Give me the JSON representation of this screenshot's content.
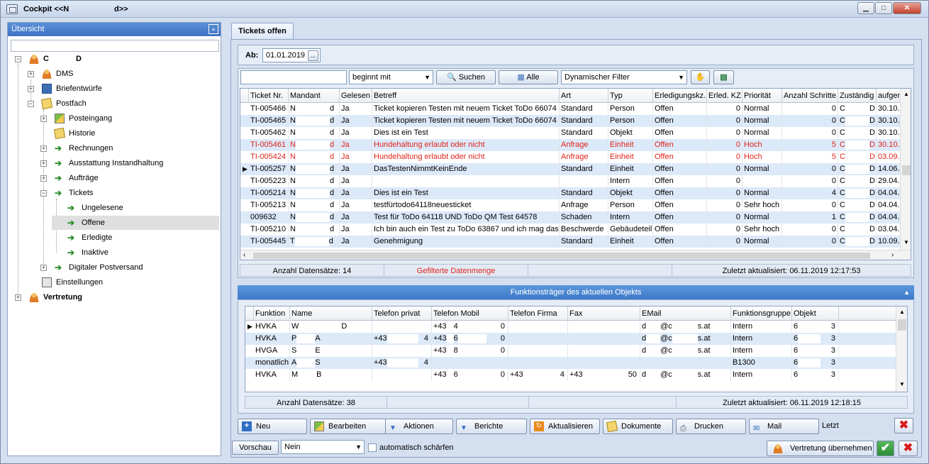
{
  "window": {
    "title": "Cockpit  <<N",
    "title_suffix": "d>>",
    "minimize": "▁",
    "maximize": "□",
    "close": "✕"
  },
  "sidebar": {
    "header": "Übersicht",
    "collapse": "«",
    "root": {
      "label": "C",
      "label2": "D"
    },
    "items": [
      {
        "label": "DMS"
      },
      {
        "label": "Briefentwürfe"
      },
      {
        "label": "Postfach"
      },
      {
        "label": "Posteingang"
      },
      {
        "label": "Historie"
      },
      {
        "label": "Rechnungen"
      },
      {
        "label": "Ausstattung Instandhaltung"
      },
      {
        "label": "Aufträge"
      },
      {
        "label": "Tickets"
      },
      {
        "label": "Ungelesene"
      },
      {
        "label": "Offene"
      },
      {
        "label": "Erledigte"
      },
      {
        "label": "Inaktive"
      },
      {
        "label": "Digitaler Postversand"
      },
      {
        "label": "Einstellungen"
      },
      {
        "label": "Vertretung"
      }
    ]
  },
  "tab": {
    "label": "Tickets offen"
  },
  "filter": {
    "ab_label": "Ab:",
    "ab_value": "01.01.2019",
    "ab_button": "...",
    "search_value": "",
    "mode_value": "beginnt mit",
    "search_button": "Suchen",
    "all_button": "Alle",
    "dynamic_filter": "Dynamischer Filter"
  },
  "tickets": {
    "columns": [
      "Ticket Nr.",
      "Mandant",
      "Gelesen",
      "Betreff",
      "Art",
      "Typ",
      "Erledigungskz.",
      "Erled. KZ",
      "Priorität",
      "Anzahl Schritte",
      "Zuständig",
      "aufgen"
    ],
    "rows": [
      {
        "nr": "TI-005466",
        "m1": "N",
        "m2": "d",
        "gel": "Ja",
        "betreff": "Ticket kopieren Testen mit neuem Ticket ToDo 66074",
        "art": "Standard",
        "typ": "Person",
        "erl": "Offen",
        "kz": "0",
        "prio": "Normal",
        "schritte": "0",
        "z1": "C",
        "z2": "D",
        "auf": "30.10."
      },
      {
        "nr": "TI-005465",
        "m1": "N",
        "m2": "d",
        "gel": "Ja",
        "betreff": "Ticket kopieren Testen mit neuem Ticket ToDo 66074",
        "art": "Standard",
        "typ": "Person",
        "erl": "Offen",
        "kz": "0",
        "prio": "Normal",
        "schritte": "0",
        "z1": "C",
        "z2": "D",
        "auf": "30.10."
      },
      {
        "nr": "TI-005462",
        "m1": "N",
        "m2": "d",
        "gel": "Ja",
        "betreff": "Dies ist ein Test",
        "art": "Standard",
        "typ": "Objekt",
        "erl": "Offen",
        "kz": "0",
        "prio": "Normal",
        "schritte": "0",
        "z1": "C",
        "z2": "D",
        "auf": "30.10."
      },
      {
        "nr": "TI-005461",
        "m1": "N",
        "m2": "d",
        "gel": "Ja",
        "betreff": "Hundehaltung erlaubt oder nicht",
        "art": "Anfrage",
        "typ": "Einheit",
        "erl": "Offen",
        "kz": "0",
        "prio": "Hoch",
        "schritte": "5",
        "z1": "C",
        "z2": "D",
        "auf": "30.10.",
        "red": true
      },
      {
        "nr": "TI-005424",
        "m1": "N",
        "m2": "d",
        "gel": "Ja",
        "betreff": "Hundehaltung erlaubt oder nicht",
        "art": "Anfrage",
        "typ": "Einheit",
        "erl": "Offen",
        "kz": "0",
        "prio": "Hoch",
        "schritte": "5",
        "z1": "C",
        "z2": "D",
        "auf": "03.09.",
        "red": true
      },
      {
        "nr": "TI-005257",
        "m1": "N",
        "m2": "d",
        "gel": "Ja",
        "betreff": "DasTestenNimmtKeinEnde",
        "art": "Standard",
        "typ": "Einheit",
        "erl": "Offen",
        "kz": "0",
        "prio": "Normal",
        "schritte": "0",
        "z1": "C",
        "z2": "D",
        "auf": "14.06."
      },
      {
        "nr": "TI-005223",
        "m1": "N",
        "m2": "d",
        "gel": "Ja",
        "betreff": "",
        "art": "",
        "typ": "Intern",
        "erl": "Offen",
        "kz": "0",
        "prio": "",
        "schritte": "0",
        "z1": "C",
        "z2": "D",
        "auf": "29.04."
      },
      {
        "nr": "TI-005214",
        "m1": "N",
        "m2": "d",
        "gel": "Ja",
        "betreff": "Dies ist ein Test",
        "art": "Standard",
        "typ": "Objekt",
        "erl": "Offen",
        "kz": "0",
        "prio": "Normal",
        "schritte": "4",
        "z1": "C",
        "z2": "D",
        "auf": "04.04."
      },
      {
        "nr": "TI-005213",
        "m1": "N",
        "m2": "d",
        "gel": "Ja",
        "betreff": "testfürtodo64118neuesticket",
        "art": "Anfrage",
        "typ": "Person",
        "erl": "Offen",
        "kz": "0",
        "prio": "Sehr hoch",
        "schritte": "0",
        "z1": "C",
        "z2": "D",
        "auf": "04.04."
      },
      {
        "nr": "009632",
        "m1": "N",
        "m2": "d",
        "gel": "Ja",
        "betreff": "Test für ToDo 64118 UND ToDo QM Test 64578",
        "art": "Schaden",
        "typ": "Intern",
        "erl": "Offen",
        "kz": "0",
        "prio": "Normal",
        "schritte": "1",
        "z1": "C",
        "z2": "D",
        "auf": "04.04."
      },
      {
        "nr": "TI-005210",
        "m1": "N",
        "m2": "d",
        "gel": "Ja",
        "betreff": "Ich bin auch ein Test zu ToDo 63867 und ich mag das",
        "art": "Beschwerde",
        "typ": "Gebäudeteil",
        "erl": "Offen",
        "kz": "0",
        "prio": "Sehr hoch",
        "schritte": "0",
        "z1": "C",
        "z2": "D",
        "auf": "03.04."
      },
      {
        "nr": "TI-005445",
        "m1": "T",
        "m2": "d",
        "gel": "Ja",
        "betreff": "Genehmigung",
        "art": "Standard",
        "typ": "Einheit",
        "erl": "Offen",
        "kz": "0",
        "prio": "Normal",
        "schritte": "0",
        "z1": "C",
        "z2": "D",
        "auf": "10.09."
      }
    ],
    "current_row_index": 5,
    "status_count": "Anzahl Datensätze: 14",
    "status_filter": "Gefilterte Datenmenge",
    "status_updated": "Zuletzt aktualisiert: 06.11.2019 12:17:53"
  },
  "functions": {
    "header": "Funktionsträger des aktuellen Objekts",
    "columns": [
      "Funktion",
      "Name",
      "Telefon privat",
      "Telefon Mobil",
      "Telefon Firma",
      "Fax",
      "EMail",
      "Funktionsgruppe",
      "Objekt"
    ],
    "rows": [
      {
        "funktion": "HVKA",
        "n1": "W",
        "n2": "D",
        "tp": "",
        "tm1": "+43",
        "tm2": "4",
        "tm3": "0",
        "tf": "",
        "fax": "",
        "e1": "d",
        "e2": "@c",
        "e3": "s.at",
        "gruppe": "Intern",
        "o1": "6",
        "o2": "3"
      },
      {
        "funktion": "HVKA",
        "n1": "P",
        "n2": "A",
        "tp": "+43",
        "tp2": "4",
        "tm1": "+43",
        "tm2": "6",
        "tm3": "0",
        "tf": "",
        "fax": "",
        "e1": "d",
        "e2": "@c",
        "e3": "s.at",
        "gruppe": "Intern",
        "o1": "6",
        "o2": "3"
      },
      {
        "funktion": "HVGA",
        "n1": "S",
        "n2": "E",
        "tp": "",
        "tm1": "+43",
        "tm2": "8",
        "tm3": "0",
        "tf": "",
        "fax": "",
        "e1": "d",
        "e2": "@c",
        "e3": "s.at",
        "gruppe": "Intern",
        "o1": "6",
        "o2": "3"
      },
      {
        "funktion": "monatlich",
        "n1": "A",
        "n2": "S",
        "tp": "+43",
        "tp2": "4",
        "tm1": "",
        "tm2": "",
        "tm3": "",
        "tf": "",
        "fax": "",
        "e1": "",
        "e2": "",
        "e3": "",
        "gruppe": "B1300",
        "o1": "6",
        "o2": "3"
      },
      {
        "funktion": "HVKA",
        "n1": "M",
        "n2": "B",
        "tp": "",
        "tm1": "+43",
        "tm2": "6",
        "tm3": "0",
        "tf": "+43",
        "tf2": "4",
        "fax": "+43",
        "fax2": "50",
        "e1": "d",
        "e2": "@c",
        "e3": "s.at",
        "gruppe": "Intern",
        "o1": "6",
        "o2": "3"
      }
    ],
    "status_count": "Anzahl Datensätze: 38",
    "status_updated": "Zuletzt aktualisiert: 06.11.2019 12:18:15"
  },
  "toolbar": {
    "neu": "Neu",
    "bearbeiten": "Bearbeiten",
    "aktionen": "Aktionen",
    "berichte": "Berichte",
    "aktualisieren": "Aktualisieren",
    "dokumente": "Dokumente",
    "drucken": "Drucken",
    "mail": "Mail",
    "letzt": "Letzt"
  },
  "bottom": {
    "vorschau": "Vorschau",
    "nein": "Nein",
    "sharpen_label": "automatisch schärfen",
    "vertretung_button": "Vertretung übernehmen"
  }
}
